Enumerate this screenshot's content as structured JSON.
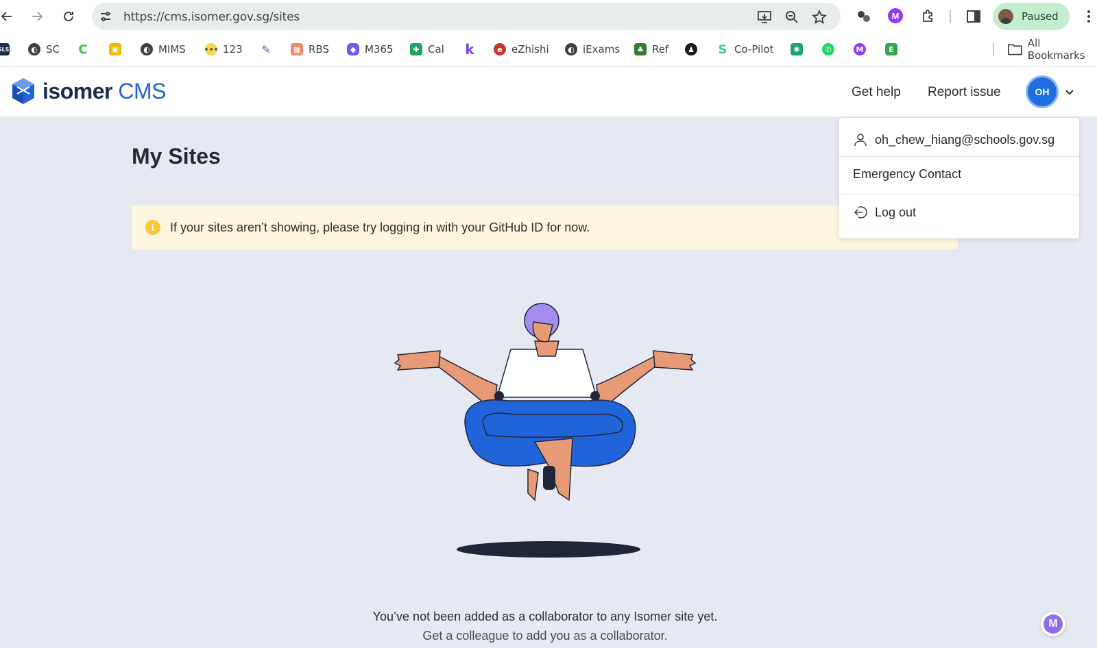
{
  "browser": {
    "url": "https://cms.isomer.gov.sg/sites",
    "profile_status": "Paused"
  },
  "bookmarks": {
    "items": [
      {
        "label": "",
        "icon": "sls-icon"
      },
      {
        "label": "SC",
        "icon": "globe-icon"
      },
      {
        "label": "",
        "icon": "c-icon"
      },
      {
        "label": "",
        "icon": "classroom-icon"
      },
      {
        "label": "MIMS",
        "icon": "globe-icon"
      },
      {
        "label": "123",
        "icon": "dots-icon"
      },
      {
        "label": "",
        "icon": "pen-icon"
      },
      {
        "label": "RBS",
        "icon": "calendar-icon"
      },
      {
        "label": "M365",
        "icon": "copilot-icon"
      },
      {
        "label": "Cal",
        "icon": "sheet-icon"
      },
      {
        "label": "",
        "icon": "k-icon"
      },
      {
        "label": "eZhishi",
        "icon": "ezhishi-icon"
      },
      {
        "label": "iExams",
        "icon": "globe-icon"
      },
      {
        "label": "Ref",
        "icon": "ref-icon"
      },
      {
        "label": "",
        "icon": "person-icon"
      },
      {
        "label": "Co-Pilot",
        "icon": "copilot-s-icon"
      },
      {
        "label": "",
        "icon": "openai-icon"
      },
      {
        "label": "",
        "icon": "whatsapp-icon"
      },
      {
        "label": "",
        "icon": "m-icon"
      },
      {
        "label": "",
        "icon": "e-icon"
      }
    ],
    "all_bookmarks": "All Bookmarks"
  },
  "header": {
    "logo_main": "isomer",
    "logo_sub": "CMS",
    "get_help": "Get help",
    "report_issue": "Report issue",
    "avatar_initials": "OH"
  },
  "dropdown": {
    "email": "oh_chew_hiang@schools.gov.sg",
    "emergency": "Emergency Contact",
    "logout": "Log out"
  },
  "main": {
    "title": "My Sites",
    "banner": "If your sites aren’t showing, please try logging in with your GitHub ID for now.",
    "empty_message": "You’ve not been added as a collaborator to any Isomer site yet.",
    "empty_sub": "Get a colleague to add you as a collaborator."
  },
  "colors": {
    "accent": "#2164da",
    "banner_bg": "#fdf6df",
    "page_bg": "#e6e9f1",
    "pants": "#2164da",
    "hair": "#a58cf0"
  }
}
